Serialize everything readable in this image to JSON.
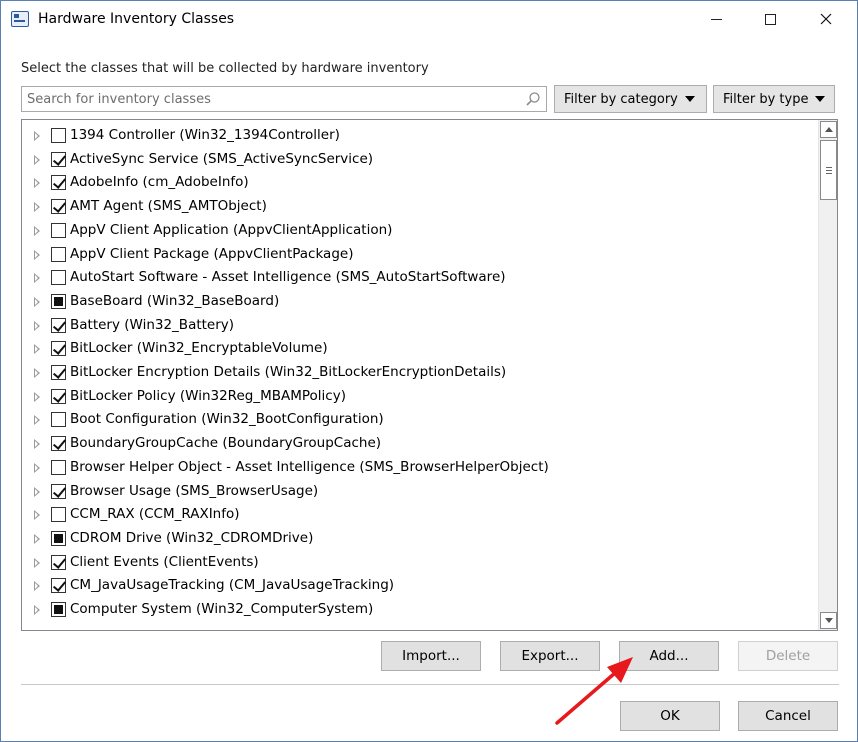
{
  "window": {
    "title": "Hardware Inventory Classes",
    "app_icon": "inventory-window-icon"
  },
  "instruction": "Select the classes that will be collected by hardware inventory",
  "search": {
    "placeholder": "Search for inventory classes",
    "value": ""
  },
  "filters": {
    "category_label": "Filter by category",
    "type_label": "Filter by type"
  },
  "classes": [
    {
      "label": "1394 Controller (Win32_1394Controller)",
      "state": "unchecked"
    },
    {
      "label": "ActiveSync Service (SMS_ActiveSyncService)",
      "state": "checked"
    },
    {
      "label": "AdobeInfo (cm_AdobeInfo)",
      "state": "checked"
    },
    {
      "label": "AMT Agent (SMS_AMTObject)",
      "state": "checked"
    },
    {
      "label": "AppV Client Application (AppvClientApplication)",
      "state": "unchecked"
    },
    {
      "label": "AppV Client Package (AppvClientPackage)",
      "state": "unchecked"
    },
    {
      "label": "AutoStart Software - Asset Intelligence (SMS_AutoStartSoftware)",
      "state": "unchecked"
    },
    {
      "label": "BaseBoard (Win32_BaseBoard)",
      "state": "partial"
    },
    {
      "label": "Battery (Win32_Battery)",
      "state": "checked"
    },
    {
      "label": "BitLocker (Win32_EncryptableVolume)",
      "state": "checked"
    },
    {
      "label": "BitLocker Encryption Details (Win32_BitLockerEncryptionDetails)",
      "state": "checked"
    },
    {
      "label": "BitLocker Policy (Win32Reg_MBAMPolicy)",
      "state": "checked"
    },
    {
      "label": "Boot Configuration (Win32_BootConfiguration)",
      "state": "unchecked"
    },
    {
      "label": "BoundaryGroupCache (BoundaryGroupCache)",
      "state": "checked"
    },
    {
      "label": "Browser Helper Object - Asset Intelligence (SMS_BrowserHelperObject)",
      "state": "unchecked"
    },
    {
      "label": "Browser Usage (SMS_BrowserUsage)",
      "state": "checked"
    },
    {
      "label": "CCM_RAX (CCM_RAXInfo)",
      "state": "unchecked"
    },
    {
      "label": "CDROM Drive (Win32_CDROMDrive)",
      "state": "partial"
    },
    {
      "label": "Client Events (ClientEvents)",
      "state": "checked"
    },
    {
      "label": "CM_JavaUsageTracking (CM_JavaUsageTracking)",
      "state": "checked"
    },
    {
      "label": "Computer System (Win32_ComputerSystem)",
      "state": "partial"
    }
  ],
  "buttons": {
    "import": "Import...",
    "export": "Export...",
    "add": "Add...",
    "delete": "Delete",
    "ok": "OK",
    "cancel": "Cancel"
  },
  "colors": {
    "annotation_arrow": "#e8191c",
    "accent": "#2c5aa0"
  }
}
